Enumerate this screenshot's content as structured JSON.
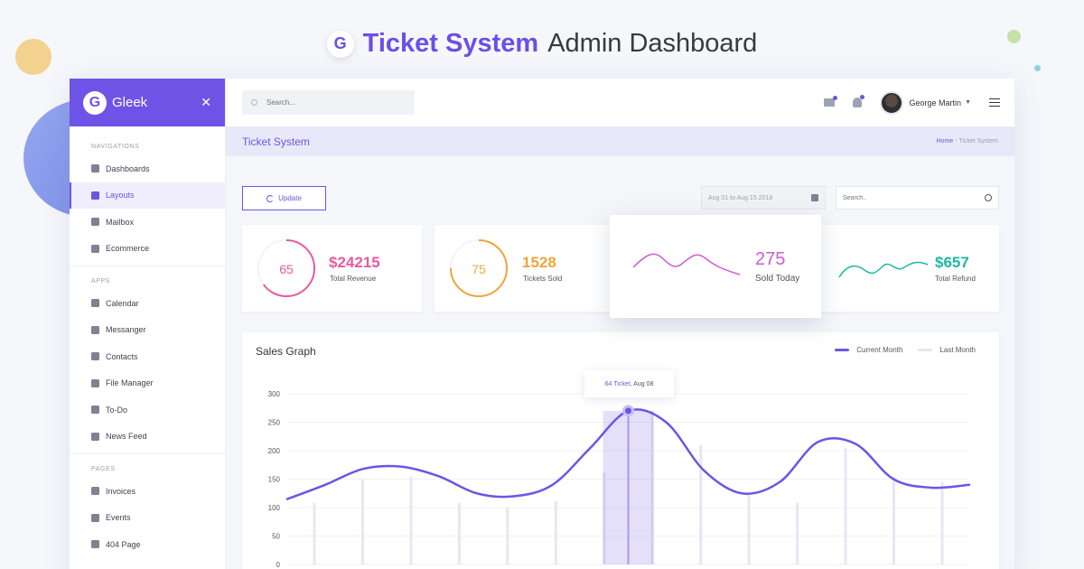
{
  "headline": {
    "logo_letter": "G",
    "strong": "Ticket System",
    "rest": "Admin Dashboard"
  },
  "colors": {
    "accent": "#6e54e6",
    "revenue": "#e85aa0",
    "tickets": "#f0a43a",
    "sold": "#c95dd3",
    "refund": "#1fb7a3"
  },
  "sidebar": {
    "brand_letter": "G",
    "brand": "Gleek",
    "tool_icon": "tools-icon",
    "sections": [
      {
        "title": "NAVIGATIONS",
        "items": [
          {
            "label": "Dashboards",
            "icon": "dashboard-icon"
          },
          {
            "label": "Layouts",
            "icon": "layout-icon",
            "active": true
          },
          {
            "label": "Mailbox",
            "icon": "mail-icon"
          },
          {
            "label": "Ecommerce",
            "icon": "cart-icon"
          }
        ]
      },
      {
        "title": "APPS",
        "items": [
          {
            "label": "Calendar",
            "icon": "calendar-icon"
          },
          {
            "label": "Messanger",
            "icon": "chat-icon"
          },
          {
            "label": "Contacts",
            "icon": "contacts-icon"
          },
          {
            "label": "File Manager",
            "icon": "folder-icon"
          },
          {
            "label": "To-Do",
            "icon": "todo-icon"
          },
          {
            "label": "News Feed",
            "icon": "news-icon"
          }
        ]
      },
      {
        "title": "PAGES",
        "items": [
          {
            "label": "Invoices",
            "icon": "invoice-icon"
          },
          {
            "label": "Events",
            "icon": "events-icon"
          },
          {
            "label": "404 Page",
            "icon": "page-icon"
          }
        ]
      }
    ]
  },
  "topbar": {
    "search_placeholder": "Search...",
    "user_name": "George Martin"
  },
  "page": {
    "title": "Ticket System",
    "crumb_home": "Home",
    "crumb_sep": " - ",
    "crumb_current": "Ticket System"
  },
  "controls": {
    "update_label": "Update",
    "date_range": "Aug 01 to Aug 15 2018",
    "search_placeholder": "Search.."
  },
  "stats": [
    {
      "ring_value": "65",
      "ring_percent": 65,
      "value": "$24215",
      "label": "Total Revenue"
    },
    {
      "ring_value": "75",
      "ring_percent": 75,
      "value": "1528",
      "label": "Tickets Sold"
    },
    {
      "value": "275",
      "label": "Sold Today"
    },
    {
      "value": "$657",
      "label": "Total Refund"
    }
  ],
  "graph": {
    "title": "Sales Graph",
    "legend": [
      {
        "name": "Current Month",
        "color": "#6e54e6"
      },
      {
        "name": "Last Month",
        "color": "#e4e8f2"
      }
    ],
    "tooltip": {
      "value": "64 Ticket",
      "date": ", Aug 08"
    }
  },
  "chart_data": {
    "type": "line",
    "title": "Sales Graph",
    "ylim": [
      0,
      300
    ],
    "yticks": [
      0,
      50,
      100,
      150,
      200,
      250,
      300
    ],
    "grid": true,
    "legend_position": "top-right",
    "series": [
      {
        "name": "Current Month",
        "color": "#6e54e6",
        "values": [
          115,
          140,
          168,
          172,
          155,
          125,
          120,
          140,
          205,
          270,
          250,
          165,
          125,
          145,
          215,
          212,
          150,
          135,
          140
        ]
      },
      {
        "name": "Last Month",
        "type": "bar",
        "color": "#e4e8f2",
        "values": [
          108,
          150,
          155,
          108,
          100,
          112,
          162,
          270,
          210,
          125,
          108,
          205,
          155,
          145
        ]
      }
    ],
    "highlight": {
      "label": "64 Ticket, Aug 08"
    }
  }
}
